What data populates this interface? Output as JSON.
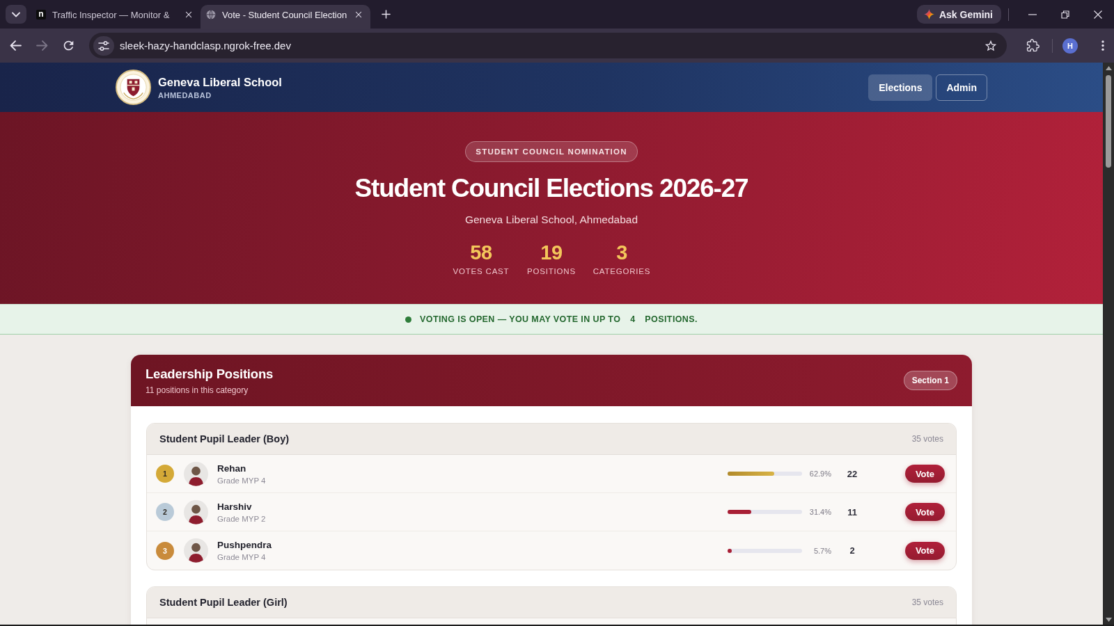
{
  "browser": {
    "tabs": [
      {
        "kind": "letter",
        "icon_text": "n",
        "title": "Traffic Inspector — Monitor &",
        "selected": false
      },
      {
        "kind": "globe",
        "title": "Vote - Student Council Election",
        "selected": true
      }
    ],
    "gemini_button": "Ask Gemini",
    "url": "sleek-hazy-handclasp.ngrok-free.dev",
    "forward_disabled": true,
    "profile_initial": "H"
  },
  "site_header": {
    "school_name": "Geneva Liberal School",
    "city": "AHMEDABAD",
    "nav": [
      {
        "label": "Elections",
        "selected": true
      },
      {
        "label": "Admin",
        "selected": false
      }
    ]
  },
  "hero": {
    "badge": "STUDENT COUNCIL NOMINATION",
    "title": "Student Council Elections 2026-27",
    "subtitle": "Geneva Liberal School, Ahmedabad",
    "stats": [
      {
        "value": "58",
        "label": "VOTES CAST"
      },
      {
        "value": "19",
        "label": "POSITIONS"
      },
      {
        "value": "3",
        "label": "CATEGORIES"
      }
    ]
  },
  "voting_banner": {
    "text": "VOTING IS OPEN — YOU MAY VOTE IN UP TO",
    "limit": "4",
    "text_end": "POSITIONS."
  },
  "categories": [
    {
      "title": "Leadership Positions",
      "subtitle": "11 positions in this category",
      "badge": "Section 1",
      "positions": [
        {
          "title": "Student Pupil Leader (Boy)",
          "votes": "35 votes",
          "candidates": [
            {
              "rank": "1",
              "color": "#d4a937",
              "name": "Rehan",
              "grade": "Grade MYP 4",
              "level": 0.629,
              "leading": true,
              "percent": "62.9%",
              "count": "22",
              "button": "Vote"
            },
            {
              "rank": "2",
              "color": "#b9cad8",
              "name": "Harshiv",
              "grade": "Grade MYP 2",
              "level": 0.314,
              "leading": false,
              "percent": "31.4%",
              "count": "11",
              "button": "Vote"
            },
            {
              "rank": "3",
              "color": "#c98b3c",
              "name": "Pushpendra",
              "grade": "Grade MYP 4",
              "level": 0.057,
              "leading": false,
              "percent": "5.7%",
              "count": "2",
              "button": "Vote"
            }
          ]
        },
        {
          "title": "Student Pupil Leader (Girl)",
          "votes": "35 votes"
        }
      ]
    }
  ]
}
